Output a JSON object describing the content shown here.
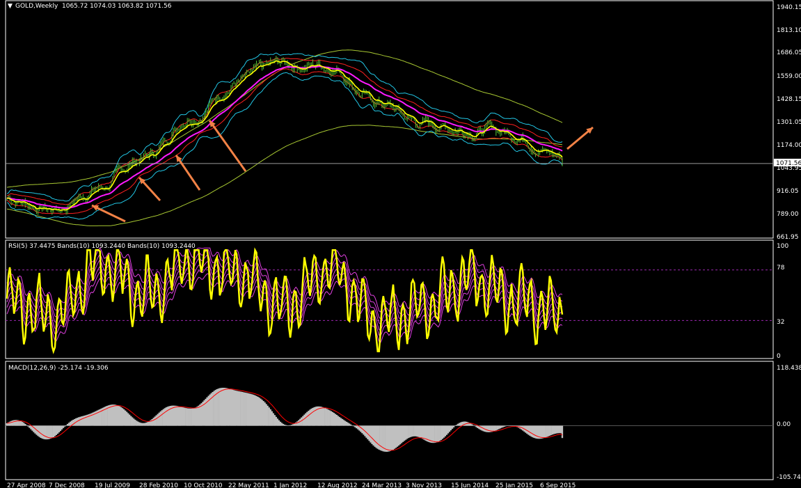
{
  "colors": {
    "background": "#000000",
    "frame": "#ffffff",
    "candles": "#55c233",
    "ma_fast": "#ffff00",
    "ma_slow": "#ff1aff",
    "bollinger_inner": "#ff2020",
    "bollinger_outer": "#22c7e6",
    "envelope": "#a8c832",
    "annotation_arrow": "#f28246",
    "rsi_line": "#ffff00",
    "rsi_bands": "#e040e0",
    "macd_hist": "#c0c0c0",
    "macd_signal": "#ff0000",
    "last_price_label_bg": "#ffffff",
    "last_price_label_fg": "#000000"
  },
  "panels": {
    "price": {
      "header": {
        "marker": "▼",
        "symbol": "GOLD,Weekly",
        "ohlc": "1065.72 1074.03 1063.82 1071.56"
      },
      "last_price": "1071.56",
      "axis_labels": [
        "1940.15",
        "1813.10",
        "1686.05",
        "1559.00",
        "1428.15",
        "1301.05",
        "1174.00",
        "1043.95",
        "916.05",
        "789.00",
        "661.95"
      ]
    },
    "rsi": {
      "header": "RSI(5) 37.4475  Bands(10) 1093.2440  Bands(10) 1093.2440",
      "axis_labels": [
        "100",
        "78",
        "32",
        "0"
      ]
    },
    "macd": {
      "header": "MACD(12,26,9) -25.174 -19.306",
      "axis_labels": [
        "118.438",
        "0.00",
        "-105.749"
      ]
    }
  },
  "time_axis": [
    "27 Apr 2008",
    "7 Dec 2008",
    "19 Jul 2009",
    "28 Feb 2010",
    "10 Oct 2010",
    "22 May 2011",
    "1 Jan 2012",
    "12 Aug 2012",
    "24 Mar 2013",
    "3 Nov 2013",
    "15 Jun 2014",
    "25 Jan 2015",
    "6 Sep 2015"
  ],
  "chart_data": [
    {
      "type": "line",
      "name": "price",
      "x": [
        "27 Apr 2008",
        "7 Dec 2008",
        "19 Jul 2009",
        "28 Feb 2010",
        "10 Oct 2010",
        "22 May 2011",
        "1 Jan 2012",
        "12 Aug 2012",
        "24 Mar 2013",
        "3 Nov 2013",
        "15 Jun 2014",
        "25 Jan 2015",
        "6 Sep 2015"
      ],
      "values": [
        880,
        820,
        940,
        1110,
        1350,
        1530,
        1620,
        1620,
        1410,
        1290,
        1270,
        1240,
        1110
      ],
      "last": 1071.56,
      "ylim": [
        661.95,
        1940.15
      ]
    },
    {
      "type": "line",
      "name": "RSI(5)",
      "x": [
        "27 Apr 2008",
        "7 Dec 2008",
        "19 Jul 2009",
        "28 Feb 2010",
        "10 Oct 2010",
        "22 May 2011",
        "1 Jan 2012",
        "12 Aug 2012",
        "24 Mar 2013",
        "3 Nov 2013",
        "15 Jun 2014",
        "25 Jan 2015",
        "6 Sep 2015"
      ],
      "values": [
        50,
        35,
        85,
        55,
        90,
        75,
        45,
        80,
        30,
        45,
        70,
        50,
        37.4475
      ],
      "levels": [
        78,
        32
      ],
      "ylim": [
        0,
        100
      ]
    },
    {
      "type": "bar",
      "name": "MACD(12,26,9)",
      "x": [
        "27 Apr 2008",
        "7 Dec 2008",
        "19 Jul 2009",
        "28 Feb 2010",
        "10 Oct 2010",
        "22 May 2011",
        "1 Jan 2012",
        "12 Aug 2012",
        "24 Mar 2013",
        "3 Nov 2013",
        "15 Jun 2014",
        "25 Jan 2015",
        "6 Sep 2015"
      ],
      "values": [
        5,
        -20,
        40,
        15,
        45,
        80,
        10,
        35,
        -45,
        -30,
        0,
        -10,
        -25.174
      ],
      "signal_last": -19.306,
      "ylim": [
        -105.749,
        118.438
      ]
    }
  ]
}
